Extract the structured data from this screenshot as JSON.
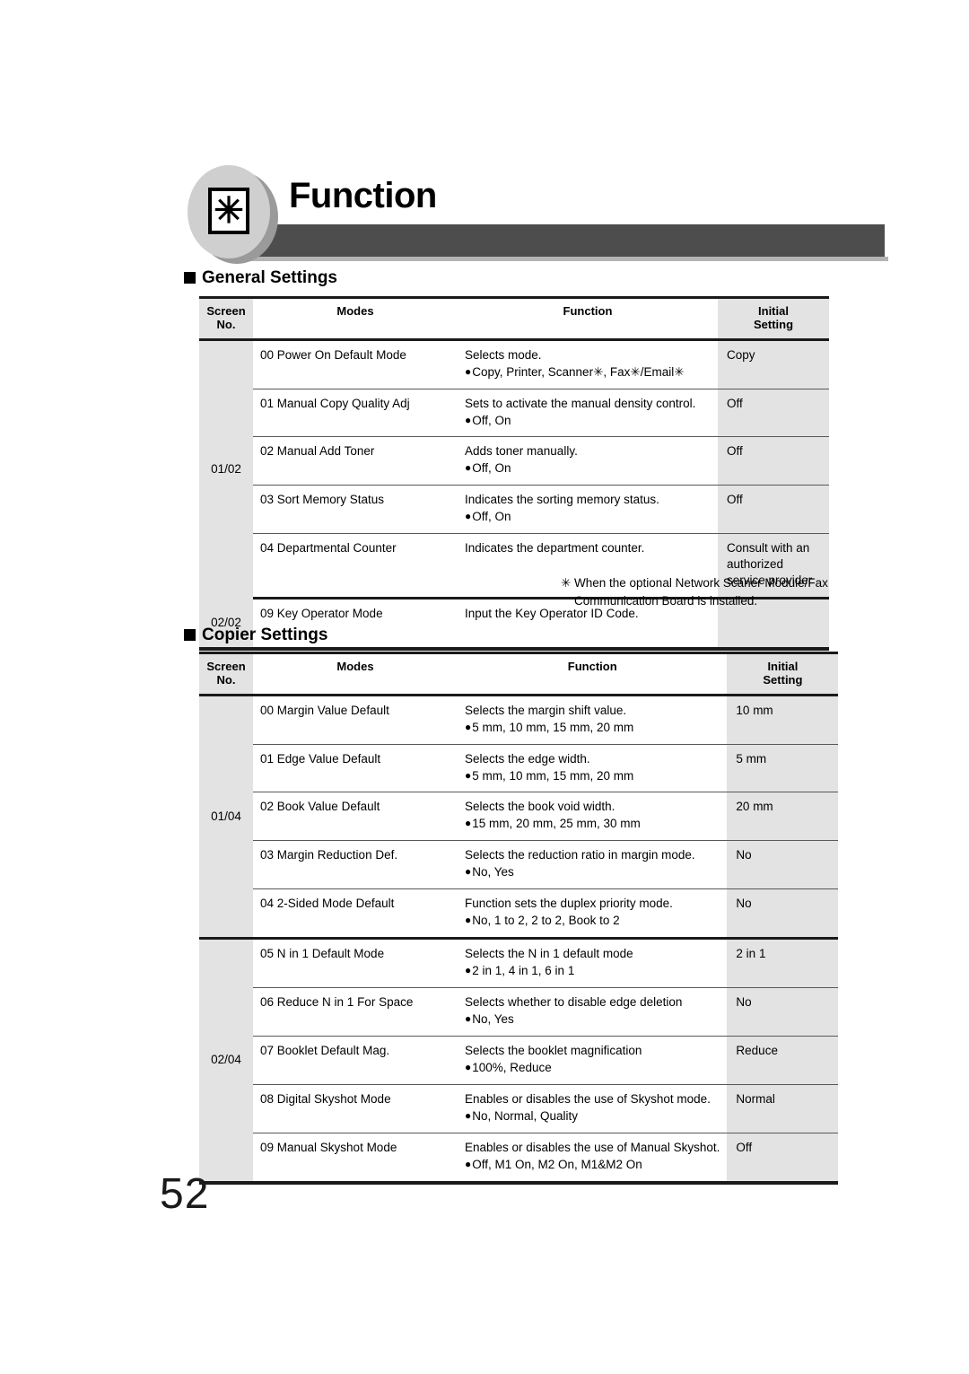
{
  "page": {
    "title": "Function",
    "badge_icon": "asterisk-icon",
    "badge_glyph": "✳",
    "number": "52",
    "colors": {
      "banner": "#4d4d4d",
      "badge": "#cfcfcf",
      "shade": "#e3e3e3",
      "rule": "#1a1a1a"
    }
  },
  "sections": [
    {
      "id": "general-settings",
      "heading": "General Settings",
      "table": {
        "columns": [
          "Screen\nNo.",
          "Modes",
          "Function",
          "Initial\nSetting"
        ],
        "col_screen_line1": "Screen",
        "col_screen_line2": "No.",
        "col_modes": "Modes",
        "col_function": "Function",
        "col_initial_line1": "Initial",
        "col_initial_line2": "Setting",
        "groups": [
          {
            "screen_no": "01/02",
            "rows": [
              {
                "mode": "00 Power On Default Mode",
                "function": "Selects mode.",
                "options": "Copy, Printer, Scanner✳, Fax✳/Email✳",
                "initial": "Copy"
              },
              {
                "mode": "01 Manual Copy Quality Adj",
                "function": "Sets to activate the manual density control.",
                "options": "Off, On",
                "initial": "Off"
              },
              {
                "mode": "02 Manual Add Toner",
                "function": "Adds toner manually.",
                "options": "Off, On",
                "initial": "Off"
              },
              {
                "mode": "03 Sort Memory Status",
                "function": "Indicates the sorting memory status.",
                "options": "Off, On",
                "initial": "Off"
              },
              {
                "mode": "04 Departmental Counter",
                "function": "Indicates the department counter.",
                "options": "",
                "initial": "Consult with an authorized service provider"
              }
            ]
          },
          {
            "screen_no": "02/02",
            "rows": [
              {
                "mode": "09 Key Operator Mode",
                "function": "Input the Key Operator ID Code.",
                "options": "",
                "initial": ""
              }
            ]
          }
        ]
      },
      "footnote": {
        "marker": "✳",
        "text": "When the optional Network Scaner Module/Fax Communication Board is installed."
      }
    },
    {
      "id": "copier-settings",
      "heading": "Copier Settings",
      "table": {
        "col_screen_line1": "Screen",
        "col_screen_line2": "No.",
        "col_modes": "Modes",
        "col_function": "Function",
        "col_initial_line1": "Initial",
        "col_initial_line2": "Setting",
        "groups": [
          {
            "screen_no": "01/04",
            "rows": [
              {
                "mode": "00 Margin Value Default",
                "function": "Selects the margin shift value.",
                "options": "5 mm, 10 mm, 15 mm, 20 mm",
                "initial": "10 mm"
              },
              {
                "mode": "01 Edge Value Default",
                "function": "Selects the edge width.",
                "options": "5 mm, 10 mm, 15 mm, 20 mm",
                "initial": "5 mm"
              },
              {
                "mode": "02 Book Value Default",
                "function": "Selects the book void width.",
                "options": "15 mm, 20 mm, 25 mm, 30 mm",
                "initial": "20 mm"
              },
              {
                "mode": "03 Margin Reduction Def.",
                "function": "Selects the reduction ratio in margin mode.",
                "options": "No, Yes",
                "initial": "No"
              },
              {
                "mode": "04 2-Sided Mode Default",
                "function": "Function sets the duplex priority mode.",
                "options": "No, 1 to 2, 2 to 2, Book to 2",
                "initial": "No"
              }
            ]
          },
          {
            "screen_no": "02/04",
            "rows": [
              {
                "mode": "05  N in 1 Default Mode",
                "function": "Selects the N in 1 default mode",
                "options": "2 in 1, 4 in 1, 6 in 1",
                "initial": "2 in 1"
              },
              {
                "mode": "06 Reduce N in 1 For Space",
                "function": "Selects whether to disable edge deletion",
                "options": "No, Yes",
                "initial": "No"
              },
              {
                "mode": "07  Booklet Default Mag.",
                "function": "Selects the booklet magnification",
                "options": "100%, Reduce",
                "initial": "Reduce"
              },
              {
                "mode": "08 Digital Skyshot Mode",
                "function": "Enables or disables the use of Skyshot mode.",
                "options": "No, Normal, Quality",
                "initial": "Normal"
              },
              {
                "mode": "09 Manual Skyshot Mode",
                "function": "Enables or disables the use of Manual Skyshot.",
                "options": "Off, M1 On, M2 On, M1&M2 On",
                "initial": "Off"
              }
            ]
          }
        ]
      }
    }
  ]
}
